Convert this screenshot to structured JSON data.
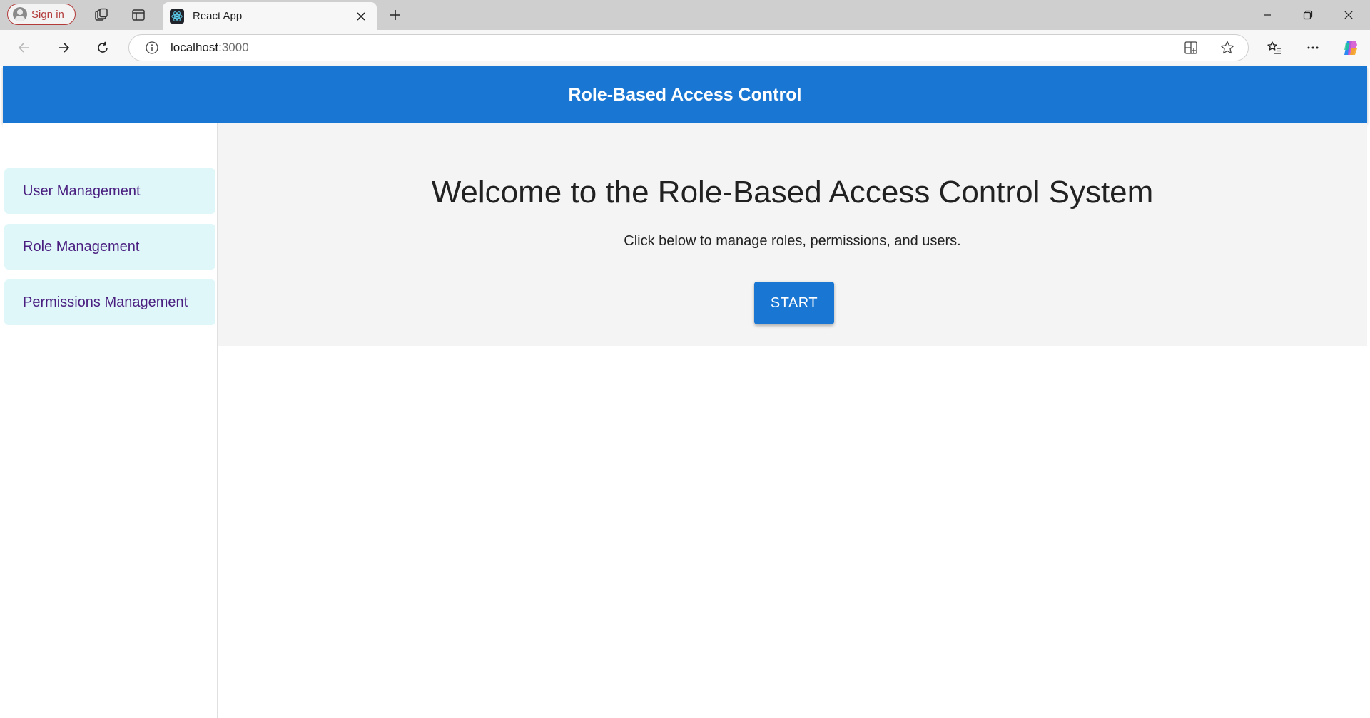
{
  "browser": {
    "signin_label": "Sign in",
    "tab": {
      "title": "React App",
      "favicon": "react-logo-icon"
    },
    "url": {
      "host": "localhost",
      "port": ":3000"
    },
    "icons": [
      "workspaces-icon",
      "vertical-tabs-icon",
      "close-icon",
      "plus-icon",
      "minimize-icon",
      "restore-icon",
      "back-icon",
      "forward-icon",
      "refresh-icon",
      "info-icon",
      "app-view-icon",
      "star-icon",
      "favorites-icon",
      "more-icon",
      "copilot-icon"
    ]
  },
  "app": {
    "title": "Role-Based Access Control",
    "accent": "#1976d2",
    "sidebar": {
      "items": [
        {
          "label": "User Management"
        },
        {
          "label": "Role Management"
        },
        {
          "label": "Permissions Management"
        }
      ]
    },
    "hero": {
      "title": "Welcome to the Role-Based Access Control System",
      "subtitle": "Click below to manage roles, permissions, and users.",
      "button": "START"
    }
  }
}
